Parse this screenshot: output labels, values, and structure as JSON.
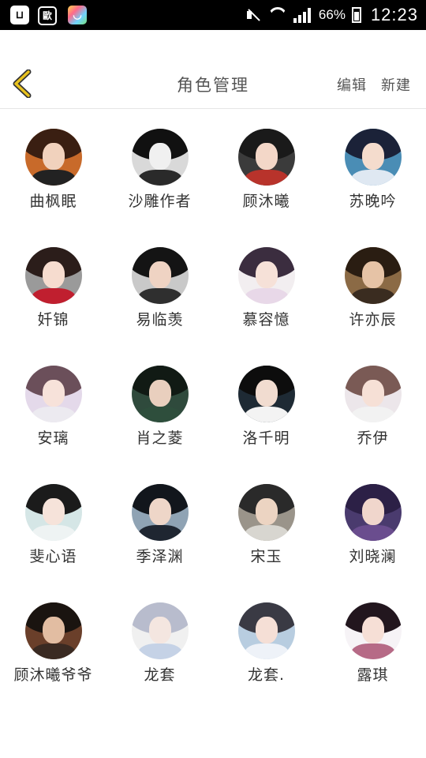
{
  "status_bar": {
    "apps": [
      "app-bag",
      "歐",
      "app-store"
    ],
    "battery": "66%",
    "time": "12:23"
  },
  "header": {
    "title": "角色管理",
    "edit_label": "编辑",
    "new_label": "新建"
  },
  "accent_color": "#e8c21e",
  "characters": [
    {
      "name": "曲枫眠",
      "bg": "#c86a2a",
      "hair": "#3a1f12",
      "face": "#f1d2bd",
      "body": "#222222"
    },
    {
      "name": "沙雕作者",
      "bg": "#d9d9d9",
      "hair": "#111111",
      "face": "#f0f0f0",
      "body": "#2a2a2a"
    },
    {
      "name": "顾沐曦",
      "bg": "#3b3b3b",
      "hair": "#1a1a1a",
      "face": "#f3d7c8",
      "body": "#b8332b"
    },
    {
      "name": "苏晚吟",
      "bg": "#4a8db5",
      "hair": "#1b2238",
      "face": "#f4dccd",
      "body": "#dfe8f2"
    },
    {
      "name": "奷锦",
      "bg": "#9a9a9a",
      "hair": "#2b1d1a",
      "face": "#f6dccf",
      "body": "#c01f2f"
    },
    {
      "name": "易临羡",
      "bg": "#c9c9c9",
      "hair": "#141414",
      "face": "#efd3c3",
      "body": "#2f2f2f"
    },
    {
      "name": "慕容憶",
      "bg": "#f2eef0",
      "hair": "#3b2d3f",
      "face": "#f6e1d8",
      "body": "#e8d8e8"
    },
    {
      "name": "许亦辰",
      "bg": "#8b6a45",
      "hair": "#2a1d12",
      "face": "#e6c3a6",
      "body": "#3a2c20"
    },
    {
      "name": "安璃",
      "bg": "#e4d9ea",
      "hair": "#6b4f5a",
      "face": "#f7e2da",
      "body": "#eceaf0"
    },
    {
      "name": "肖之菱",
      "bg": "#2f4a3c",
      "hair": "#111a14",
      "face": "#e9cfbe",
      "body": "#2e4e3c"
    },
    {
      "name": "洛千明",
      "bg": "#1e2a34",
      "hair": "#0d0d0d",
      "face": "#f1dcd0",
      "body": "#f3f3f3"
    },
    {
      "name": "乔伊",
      "bg": "#ece6ea",
      "hair": "#7a5a55",
      "face": "#f6e0d6",
      "body": "#f2f2f2"
    },
    {
      "name": "斐心语",
      "bg": "#d5e6e6",
      "hair": "#1b1b1b",
      "face": "#f6e3da",
      "body": "#eef3f3"
    },
    {
      "name": "季泽渊",
      "bg": "#8fa3b4",
      "hair": "#12161c",
      "face": "#eed6c8",
      "body": "#1f2631"
    },
    {
      "name": "宋玉",
      "bg": "#9a948a",
      "hair": "#2a2a2a",
      "face": "#ecd4c2",
      "body": "#d8d6d0"
    },
    {
      "name": "刘晓澜",
      "bg": "#4a3b6e",
      "hair": "#2c2046",
      "face": "#f0d6cc",
      "body": "#6a4d8e"
    },
    {
      "name": "顾沐曦爷爷",
      "bg": "#6a3f2a",
      "hair": "#1a1410",
      "face": "#e2bda2",
      "body": "#3a2a22"
    },
    {
      "name": "龙套",
      "bg": "#f0f0f0",
      "hair": "#b8bccd",
      "face": "#f4e6e0",
      "body": "#c5d2e6"
    },
    {
      "name": "龙套.",
      "bg": "#b8cde0",
      "hair": "#3a3a44",
      "face": "#f5dfd6",
      "body": "#eef2f8"
    },
    {
      "name": "露琪",
      "bg": "#f6f3f6",
      "hair": "#22161e",
      "face": "#f6dfd6",
      "body": "#b66a86"
    }
  ]
}
